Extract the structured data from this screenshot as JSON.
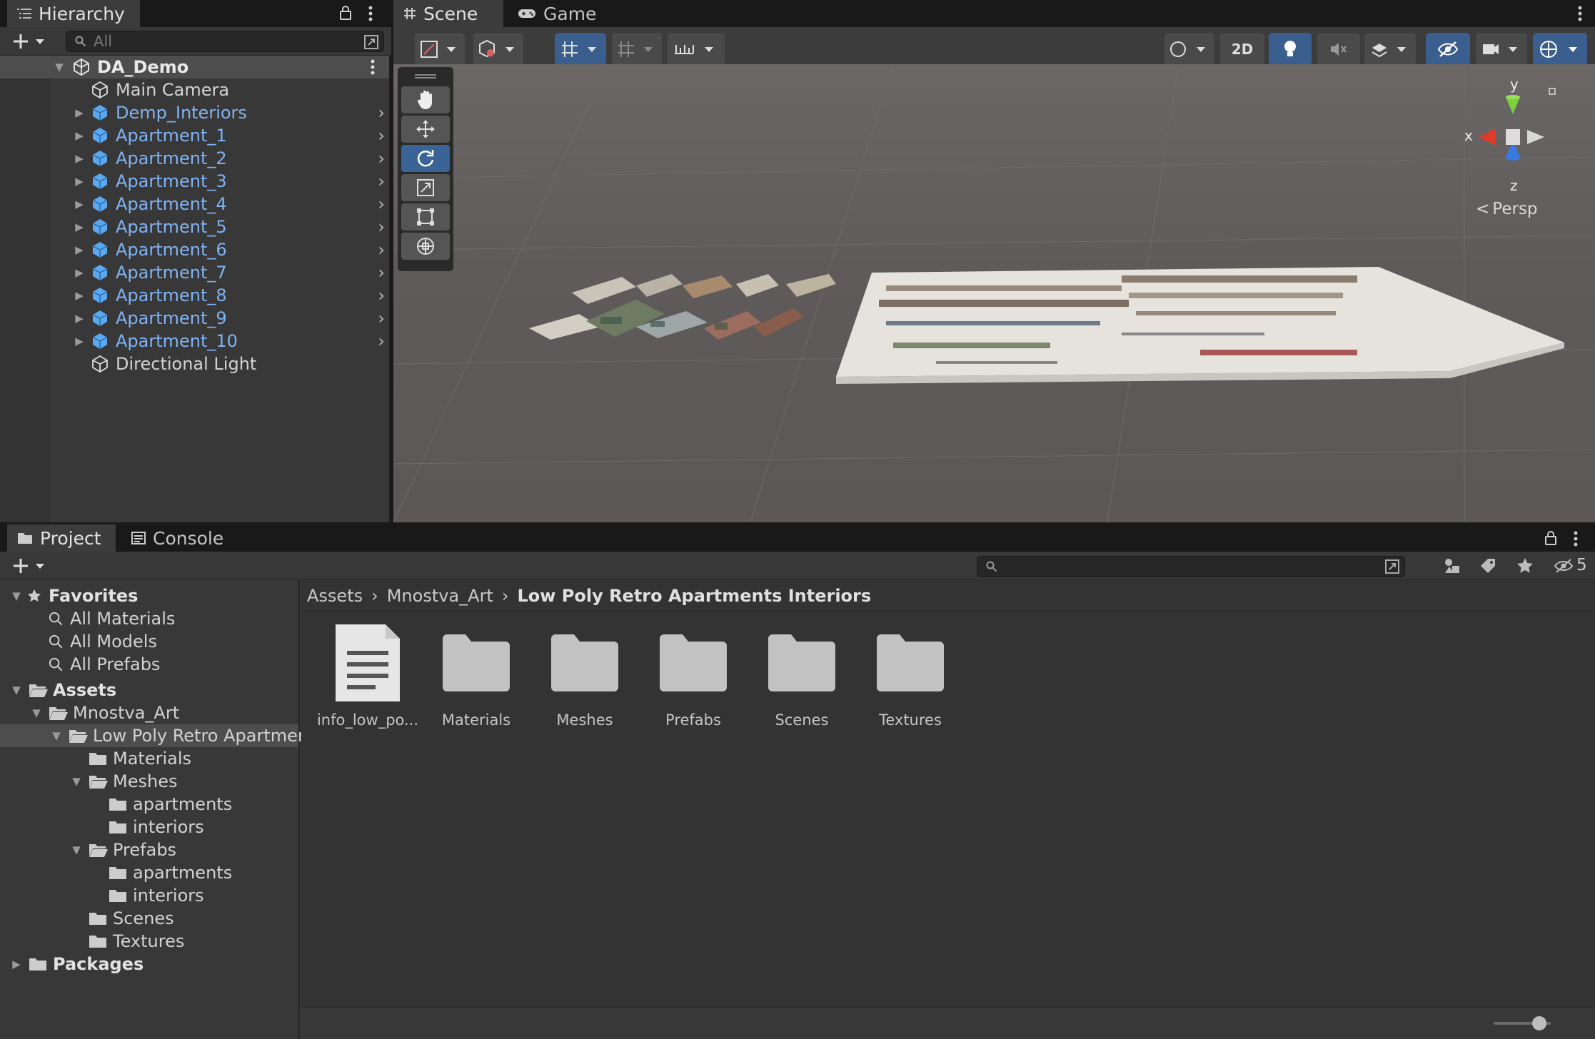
{
  "hierarchy": {
    "tab_label": "Hierarchy",
    "search_placeholder": "All",
    "scene_name": "DA_Demo",
    "items": [
      {
        "label": "Main Camera",
        "prefab": false,
        "expandable": false
      },
      {
        "label": "Demp_Interiors",
        "prefab": true,
        "expandable": true
      },
      {
        "label": "Apartment_1",
        "prefab": true,
        "expandable": true
      },
      {
        "label": "Apartment_2",
        "prefab": true,
        "expandable": true
      },
      {
        "label": "Apartment_3",
        "prefab": true,
        "expandable": true
      },
      {
        "label": "Apartment_4",
        "prefab": true,
        "expandable": true
      },
      {
        "label": "Apartment_5",
        "prefab": true,
        "expandable": true
      },
      {
        "label": "Apartment_6",
        "prefab": true,
        "expandable": true
      },
      {
        "label": "Apartment_7",
        "prefab": true,
        "expandable": true
      },
      {
        "label": "Apartment_8",
        "prefab": true,
        "expandable": true
      },
      {
        "label": "Apartment_9",
        "prefab": true,
        "expandable": true
      },
      {
        "label": "Apartment_10",
        "prefab": true,
        "expandable": true
      },
      {
        "label": "Directional Light",
        "prefab": false,
        "expandable": false
      }
    ]
  },
  "scene_view": {
    "tab_scene": "Scene",
    "tab_game": "Game",
    "toolbar_2d": "2D",
    "gizmo": {
      "y": "y",
      "x": "x",
      "z": "z",
      "projection": "Persp"
    }
  },
  "project": {
    "tab_project": "Project",
    "tab_console": "Console",
    "hidden_count": "5",
    "breadcrumb": [
      "Assets",
      "Mnostva_Art",
      "Low Poly Retro Apartments Interiors"
    ],
    "favorites": {
      "label": "Favorites",
      "items": [
        "All Materials",
        "All Models",
        "All Prefabs"
      ]
    },
    "tree": [
      {
        "label": "Assets",
        "depth": 0,
        "open": true,
        "bold": true
      },
      {
        "label": "Mnostva_Art",
        "depth": 1,
        "open": true
      },
      {
        "label": "Low Poly Retro Apartment",
        "depth": 2,
        "open": true,
        "selected": true
      },
      {
        "label": "Materials",
        "depth": 3,
        "open": false,
        "leaf": true
      },
      {
        "label": "Meshes",
        "depth": 3,
        "open": true
      },
      {
        "label": "apartments",
        "depth": 4,
        "leaf": true
      },
      {
        "label": "interiors",
        "depth": 4,
        "leaf": true
      },
      {
        "label": "Prefabs",
        "depth": 3,
        "open": true
      },
      {
        "label": "apartments",
        "depth": 4,
        "leaf": true
      },
      {
        "label": "interiors",
        "depth": 4,
        "leaf": true
      },
      {
        "label": "Scenes",
        "depth": 3,
        "leaf": true
      },
      {
        "label": "Textures",
        "depth": 3,
        "leaf": true
      },
      {
        "label": "Packages",
        "depth": 0,
        "open": false,
        "bold": true
      }
    ],
    "assets": [
      {
        "label": "info_low_po...",
        "kind": "document"
      },
      {
        "label": "Materials",
        "kind": "folder"
      },
      {
        "label": "Meshes",
        "kind": "folder"
      },
      {
        "label": "Prefabs",
        "kind": "folder"
      },
      {
        "label": "Scenes",
        "kind": "folder"
      },
      {
        "label": "Textures",
        "kind": "folder"
      }
    ]
  },
  "colors": {
    "panel_bg": "#383838",
    "toolbar_bg": "#3c3c3c",
    "selection": "#2c5d87",
    "prefab_blue": "#7fb3f5"
  }
}
